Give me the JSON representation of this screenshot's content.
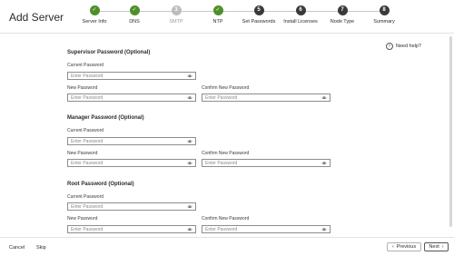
{
  "page": {
    "title": "Add Server"
  },
  "stepper": {
    "steps": [
      {
        "label": "Server Info",
        "badge": "✓",
        "state": "done"
      },
      {
        "label": "DNS",
        "badge": "✓",
        "state": "done"
      },
      {
        "label": "SMTP",
        "badge": "3",
        "state": "disabled"
      },
      {
        "label": "NTP",
        "badge": "✓",
        "state": "done"
      },
      {
        "label": "Set Passwords",
        "badge": "5",
        "state": "current"
      },
      {
        "label": "Install Licenses",
        "badge": "6",
        "state": "todo"
      },
      {
        "label": "Node Type",
        "badge": "7",
        "state": "todo"
      },
      {
        "label": "Summary",
        "badge": "8",
        "state": "todo"
      }
    ]
  },
  "help": {
    "label": "Need help?"
  },
  "sections": [
    {
      "title": "Supervisor Password (Optional)",
      "current_label": "Current Password",
      "current_placeholder": "Enter Password",
      "new_label": "New Password",
      "new_placeholder": "Enter Password",
      "confirm_label": "Confirm New Password",
      "confirm_placeholder": "Enter Password"
    },
    {
      "title": "Manager Password (Optional)",
      "current_label": "Current Password",
      "current_placeholder": "Enter Password",
      "new_label": "New Password",
      "new_placeholder": "Enter Password",
      "confirm_label": "Confirm New Password",
      "confirm_placeholder": "Enter Password"
    },
    {
      "title": "Root Password (Optional)",
      "current_label": "Current Password",
      "current_placeholder": "Enter Password",
      "new_label": "New Password",
      "new_placeholder": "Enter Password",
      "confirm_label": "Confirm New Password",
      "confirm_placeholder": "Enter Password"
    }
  ],
  "footer": {
    "cancel_label": "Cancel",
    "skip_label": "Skip",
    "previous_label": "Previous",
    "next_label": "Next"
  },
  "colors": {
    "step_done": "#4f8f2b",
    "step_active": "#3a3a3a",
    "step_disabled": "#bdbdbd",
    "field_border": "#8d8d8d"
  }
}
